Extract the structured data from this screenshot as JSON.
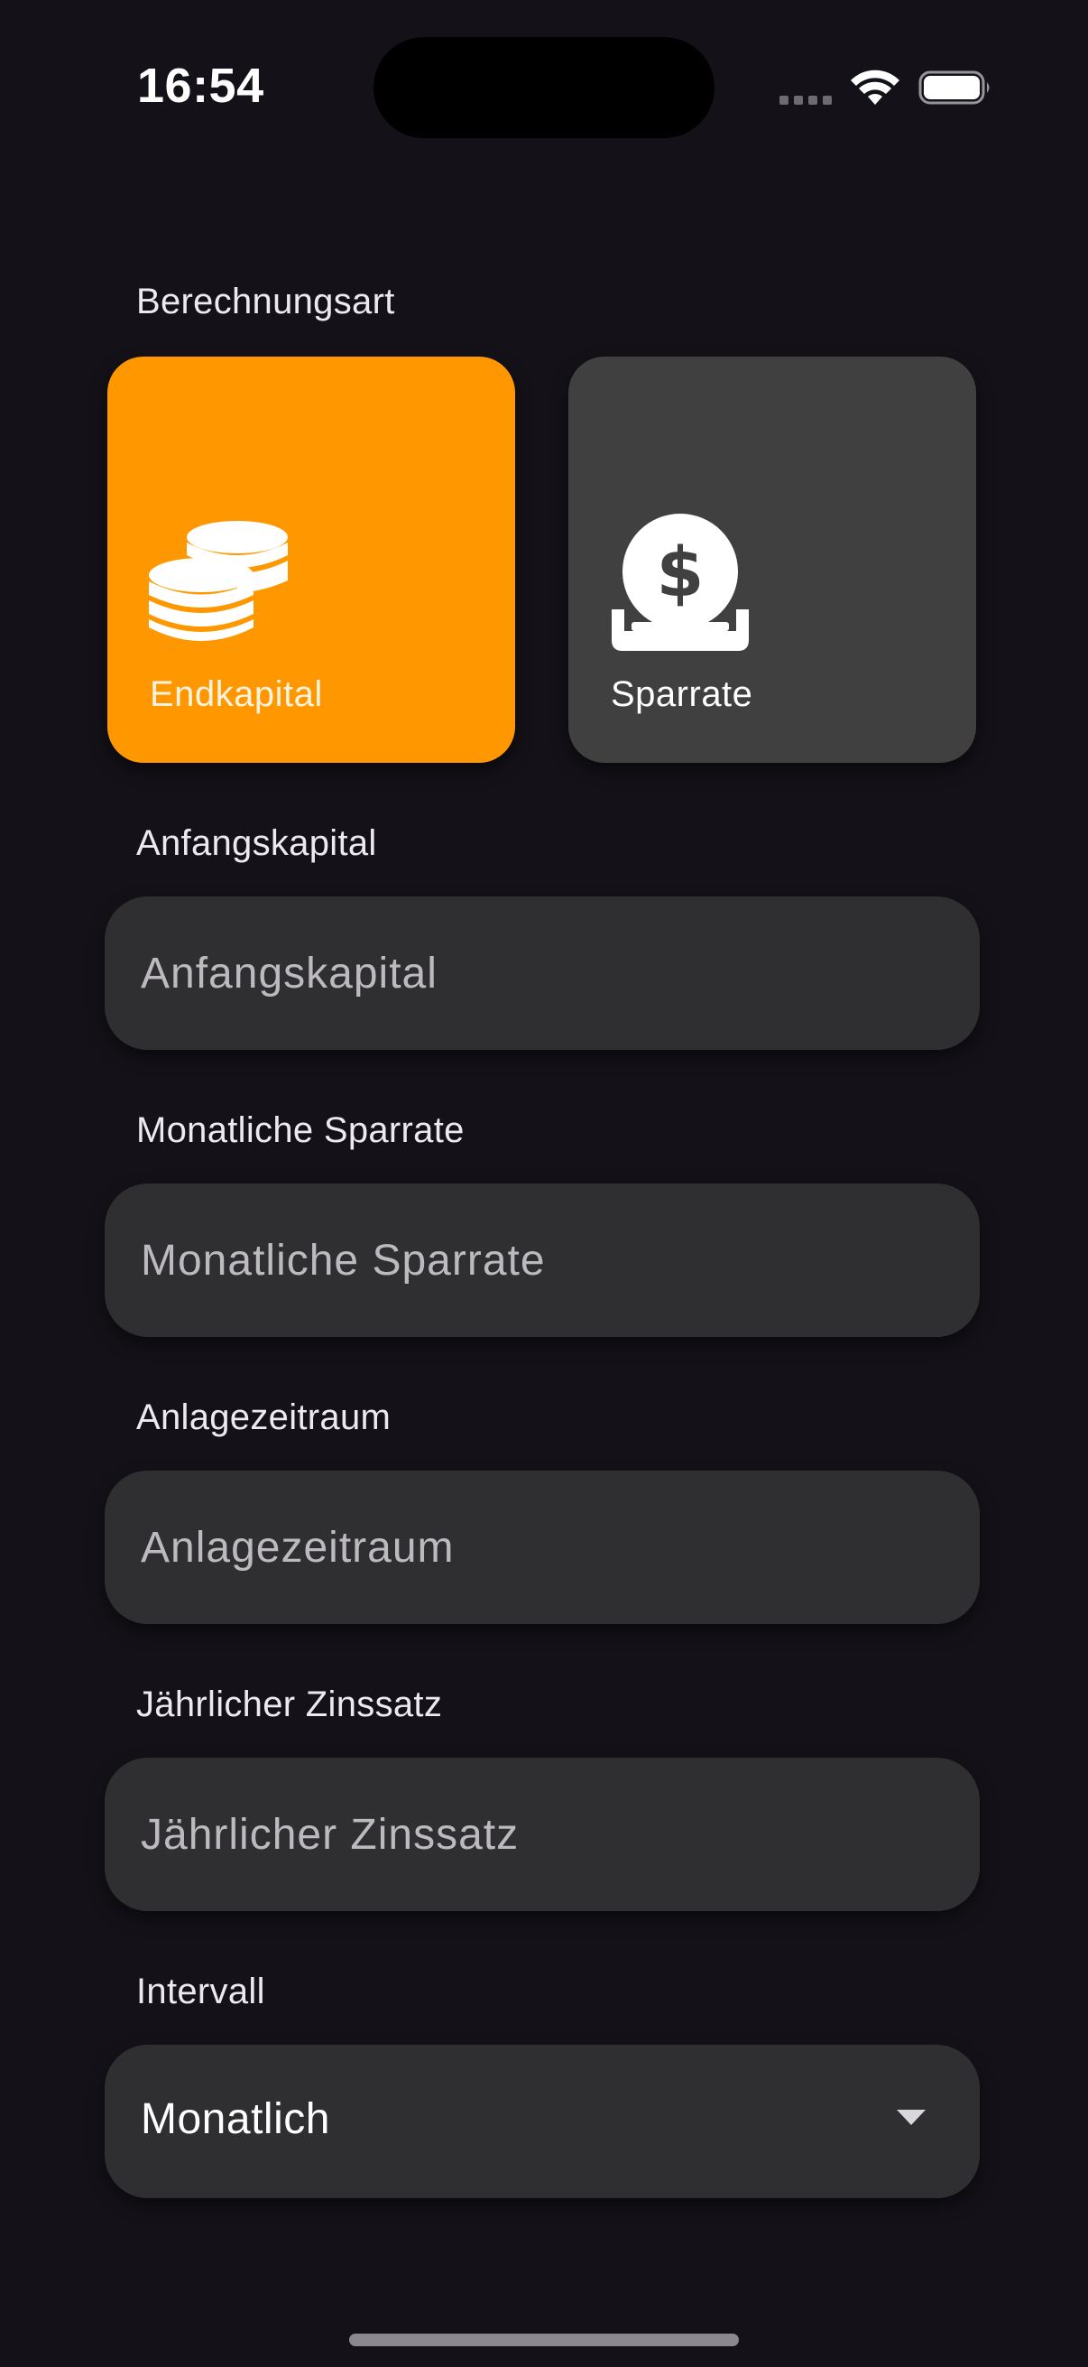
{
  "status_bar": {
    "time": "16:54"
  },
  "calc_type": {
    "label": "Berechnungsart",
    "options": [
      {
        "label": "Endkapital",
        "icon": "coins-icon",
        "selected": true
      },
      {
        "label": "Sparrate",
        "icon": "dollar-deposit-icon",
        "selected": false
      }
    ],
    "selected_color": "#ff9800",
    "unselected_color": "#404040"
  },
  "fields": {
    "anfangskapital": {
      "label": "Anfangskapital",
      "placeholder": "Anfangskapital",
      "value": ""
    },
    "sparrate": {
      "label": "Monatliche Sparrate",
      "placeholder": "Monatliche Sparrate",
      "value": ""
    },
    "zeitraum": {
      "label": "Anlagezeitraum",
      "placeholder": "Anlagezeitraum",
      "value": ""
    },
    "zinssatz": {
      "label": "Jährlicher Zinssatz",
      "placeholder": "Jährlicher Zinssatz",
      "value": ""
    }
  },
  "interval": {
    "label": "Intervall",
    "selected": "Monatlich"
  },
  "theme": {
    "background": "#141218",
    "field_background": "#2f2f31",
    "accent": "#ff9800"
  }
}
